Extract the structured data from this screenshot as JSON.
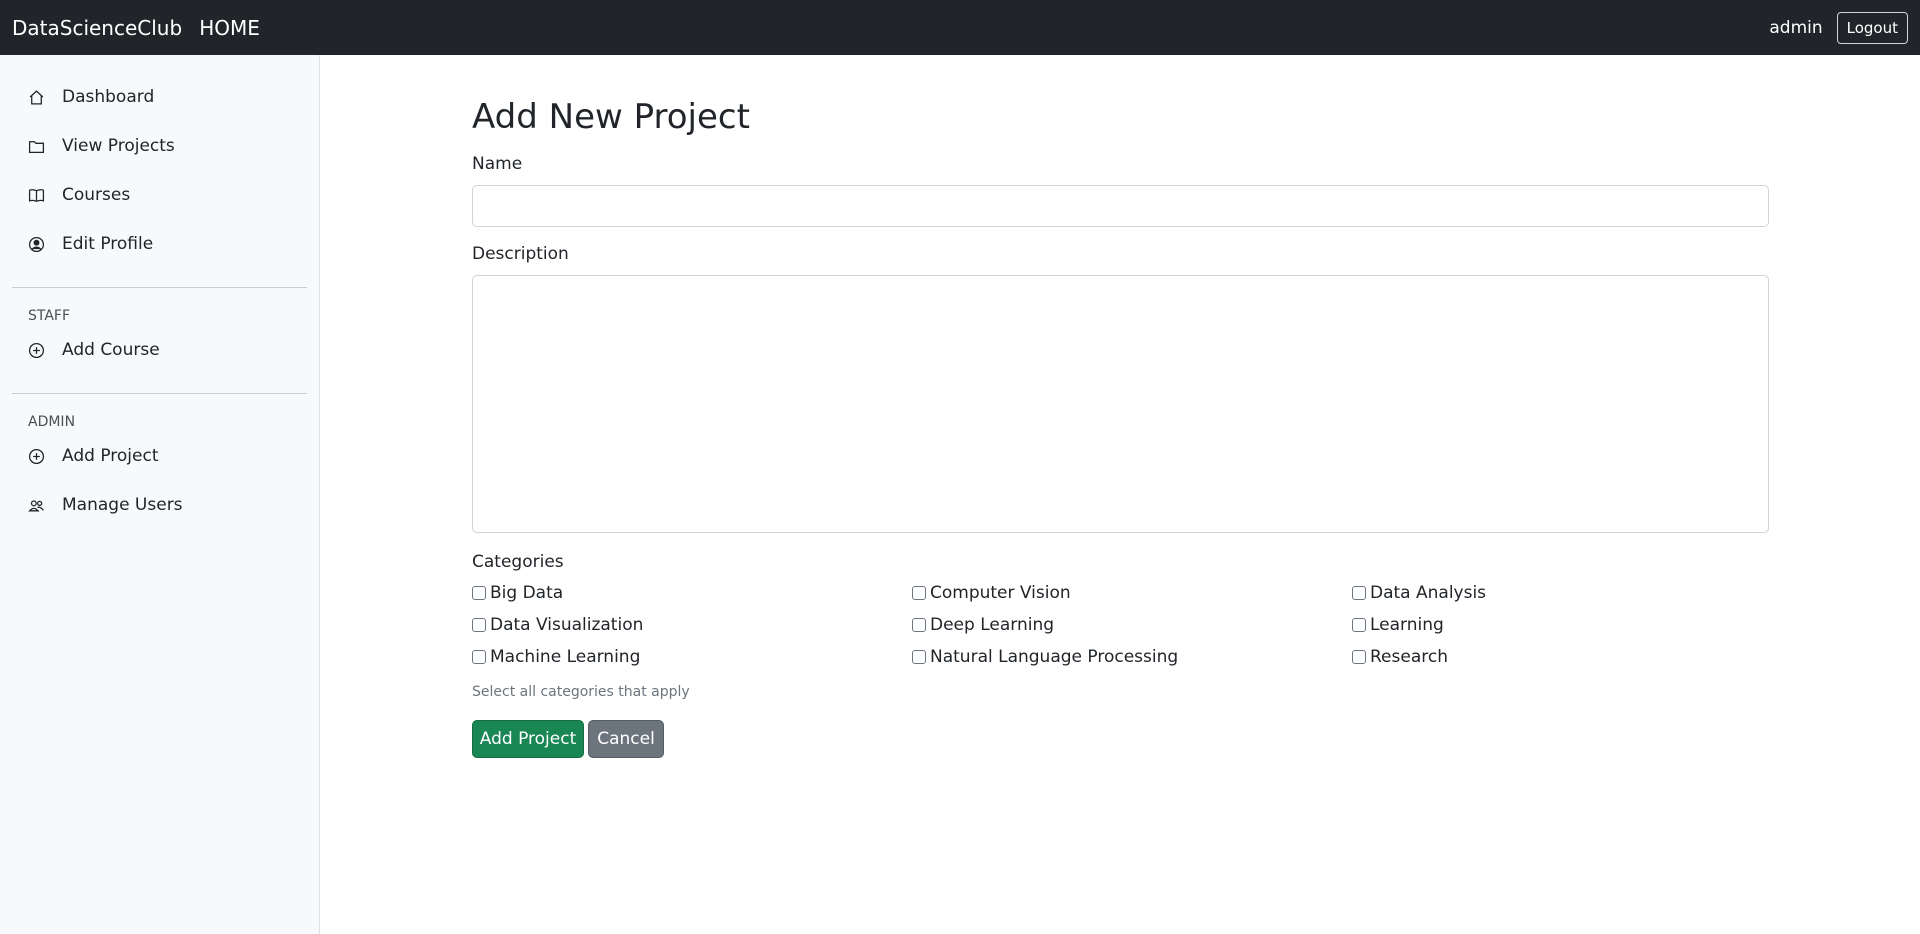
{
  "navbar": {
    "brand": "DataScienceClub",
    "home": "HOME",
    "username": "admin",
    "logout": "Logout"
  },
  "sidebar": {
    "items": [
      {
        "label": "Dashboard",
        "icon": "house-icon"
      },
      {
        "label": "View Projects",
        "icon": "folder-icon"
      },
      {
        "label": "Courses",
        "icon": "book-icon"
      },
      {
        "label": "Edit Profile",
        "icon": "person-circle-icon"
      }
    ],
    "staff": {
      "heading": "STAFF",
      "items": [
        {
          "label": "Add Course",
          "icon": "plus-circle-icon"
        }
      ]
    },
    "admin": {
      "heading": "ADMIN",
      "items": [
        {
          "label": "Add Project",
          "icon": "plus-circle-icon"
        },
        {
          "label": "Manage Users",
          "icon": "people-icon"
        }
      ]
    }
  },
  "form": {
    "title": "Add New Project",
    "name_label": "Name",
    "name_value": "",
    "description_label": "Description",
    "description_value": "",
    "categories_label": "Categories",
    "categories": [
      {
        "label": "Big Data",
        "checked": false
      },
      {
        "label": "Computer Vision",
        "checked": false
      },
      {
        "label": "Data Analysis",
        "checked": false
      },
      {
        "label": "Data Visualization",
        "checked": false
      },
      {
        "label": "Deep Learning",
        "checked": false
      },
      {
        "label": "Learning",
        "checked": false
      },
      {
        "label": "Machine Learning",
        "checked": false
      },
      {
        "label": "Natural Language Processing",
        "checked": false
      },
      {
        "label": "Research",
        "checked": false
      }
    ],
    "categories_help": "Select all categories that apply",
    "submit_label": "Add Project",
    "cancel_label": "Cancel"
  },
  "colors": {
    "navbar": "#212529",
    "success": "#198754",
    "secondary": "#6c757d",
    "sidebar_bg": "#f8f9fa"
  }
}
